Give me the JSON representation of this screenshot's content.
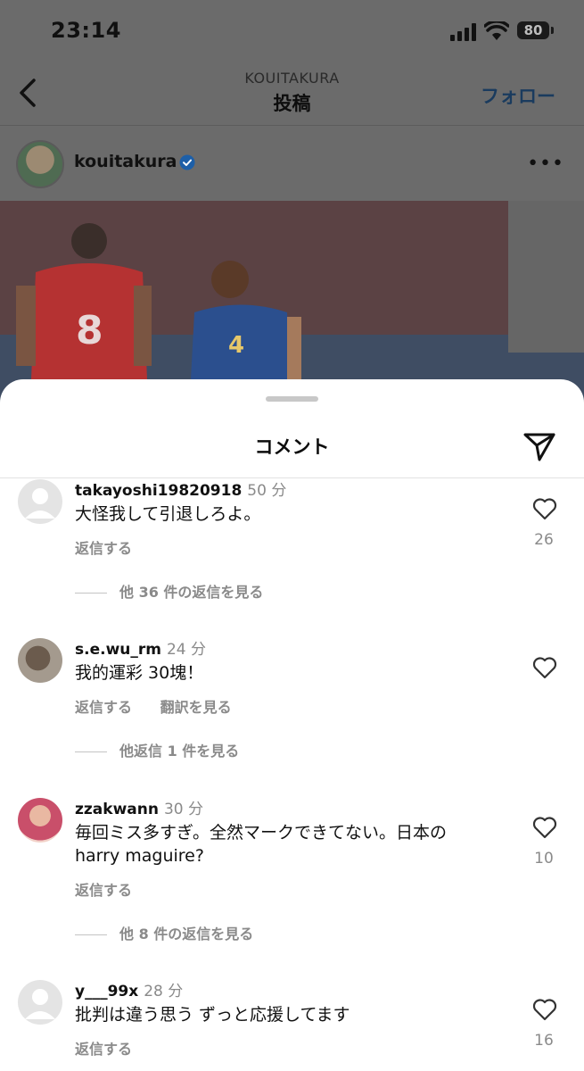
{
  "status": {
    "time": "23:14",
    "battery": "80"
  },
  "nav": {
    "subtitle": "KOUITAKURA",
    "title": "投稿",
    "follow": "フォロー"
  },
  "author": {
    "username": "kouitakura",
    "more": "•••"
  },
  "sheet": {
    "title": "コメント"
  },
  "comments": [
    {
      "username": "takayoshi19820918",
      "time": "50 分",
      "text": "大怪我して引退しろよ。",
      "reply": "返信する",
      "translate": "",
      "more_replies": "他 36 件の返信を見る",
      "likes": "26"
    },
    {
      "username": "s.e.wu_rm",
      "time": "24 分",
      "text": "我的運彩 30塊！",
      "reply": "返信する",
      "translate": "翻訳を見る",
      "more_replies": "他返信 1 件を見る",
      "likes": ""
    },
    {
      "username": "zzakwann",
      "time": "30 分",
      "text": "毎回ミス多すぎ。全然マークできてない。日本の harry maguire?",
      "reply": "返信する",
      "translate": "",
      "more_replies": "他 8 件の返信を見る",
      "likes": "10"
    },
    {
      "username": "y___99x",
      "time": "28 分",
      "text": "批判は違う思う ずっと応援してます",
      "reply": "返信する",
      "translate": "",
      "more_replies": "",
      "likes": "16"
    }
  ],
  "icons": {
    "back": "chevron-left-icon",
    "verified": "verified-badge-icon",
    "send": "send-icon",
    "heart": "heart-icon",
    "signal": "signal-icon",
    "wifi": "wifi-icon",
    "battery": "battery-icon"
  },
  "colors": {
    "overlay": "#6b6b6b",
    "follow": "#1a3b5e",
    "verified": "#1d5fa8",
    "muted": "#8a8a8a"
  }
}
